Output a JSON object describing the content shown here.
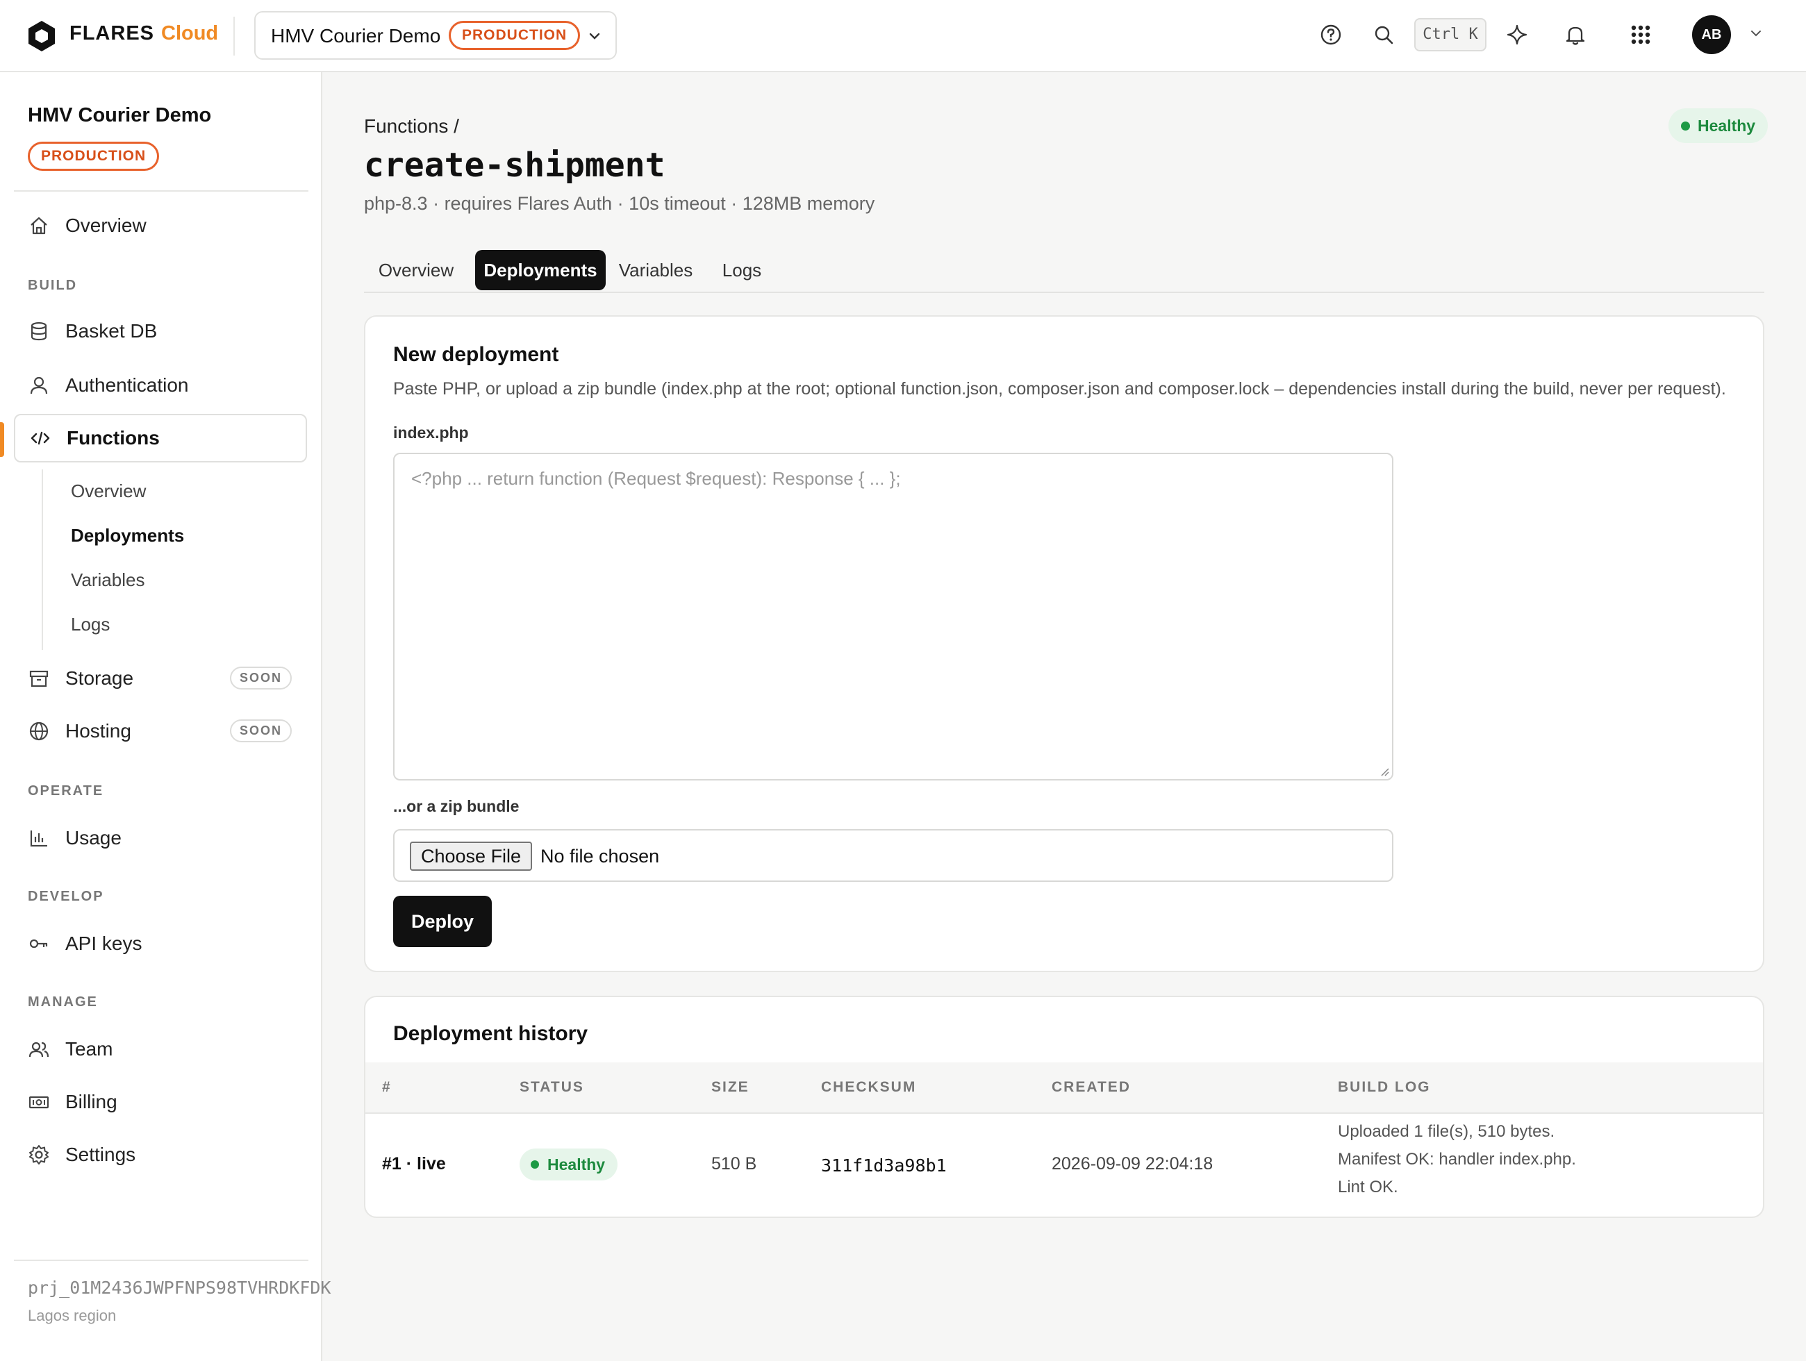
{
  "topbar": {
    "brand": "FLARES",
    "brand_suffix": "Cloud",
    "project_name": "HMV Courier Demo",
    "environment": "PRODUCTION",
    "shortcut": "Ctrl K",
    "avatar_initials": "AB",
    "icons": [
      "help-icon",
      "search-icon",
      "sparkle-icon",
      "bell-icon",
      "apps-grid-icon",
      "chevron-down-icon"
    ]
  },
  "sidebar": {
    "project_name": "HMV Courier Demo",
    "environment": "PRODUCTION",
    "overview": "Overview",
    "sections": {
      "build": "BUILD",
      "operate": "OPERATE",
      "develop": "DEVELOP",
      "manage": "MANAGE"
    },
    "items": {
      "basket_db": "Basket DB",
      "authentication": "Authentication",
      "functions": "Functions",
      "storage": "Storage",
      "hosting": "Hosting",
      "usage": "Usage",
      "api_keys": "API keys",
      "team": "Team",
      "billing": "Billing",
      "settings": "Settings"
    },
    "soon_badge": "SOON",
    "function_sub": [
      "Overview",
      "Deployments",
      "Variables",
      "Logs"
    ],
    "footer_id": "prj_01M2436JWPFNPS98TVHRDKFDK",
    "footer_region": "Lagos region"
  },
  "page": {
    "breadcrumb": "Functions /",
    "title": "create-shipment",
    "subtitle": "php-8.3 · requires Flares Auth · 10s timeout · 128MB memory",
    "status": "Healthy",
    "tabs": [
      "Overview",
      "Deployments",
      "Variables",
      "Logs"
    ],
    "active_tab": "Deployments"
  },
  "new_deployment": {
    "heading": "New deployment",
    "description": "Paste PHP, or upload a zip bundle (index.php at the root; optional function.json, composer.json and composer.lock – dependencies install during the build, never per request).",
    "code_label": "index.php",
    "code_placeholder": "<?php ... return function (Request $request): Response { ... };",
    "zip_label": "...or a zip bundle",
    "choose_file": "Choose File",
    "no_file": "No file chosen",
    "deploy_button": "Deploy"
  },
  "history": {
    "heading": "Deployment history",
    "columns": [
      "#",
      "STATUS",
      "SIZE",
      "CHECKSUM",
      "CREATED",
      "BUILD LOG"
    ],
    "rows": [
      {
        "id": "#1 · live",
        "status": "Healthy",
        "size": "510 B",
        "checksum": "311f1d3a98b1",
        "created": "2026-09-09 22:04:18",
        "build_log": [
          "Uploaded 1 file(s), 510 bytes.",
          "Manifest OK: handler index.php.",
          "Lint OK."
        ]
      }
    ]
  },
  "colors": {
    "accent": "#f08a24",
    "production": "#e8622c",
    "healthy": "#1d8a3e",
    "dark": "#111111"
  }
}
